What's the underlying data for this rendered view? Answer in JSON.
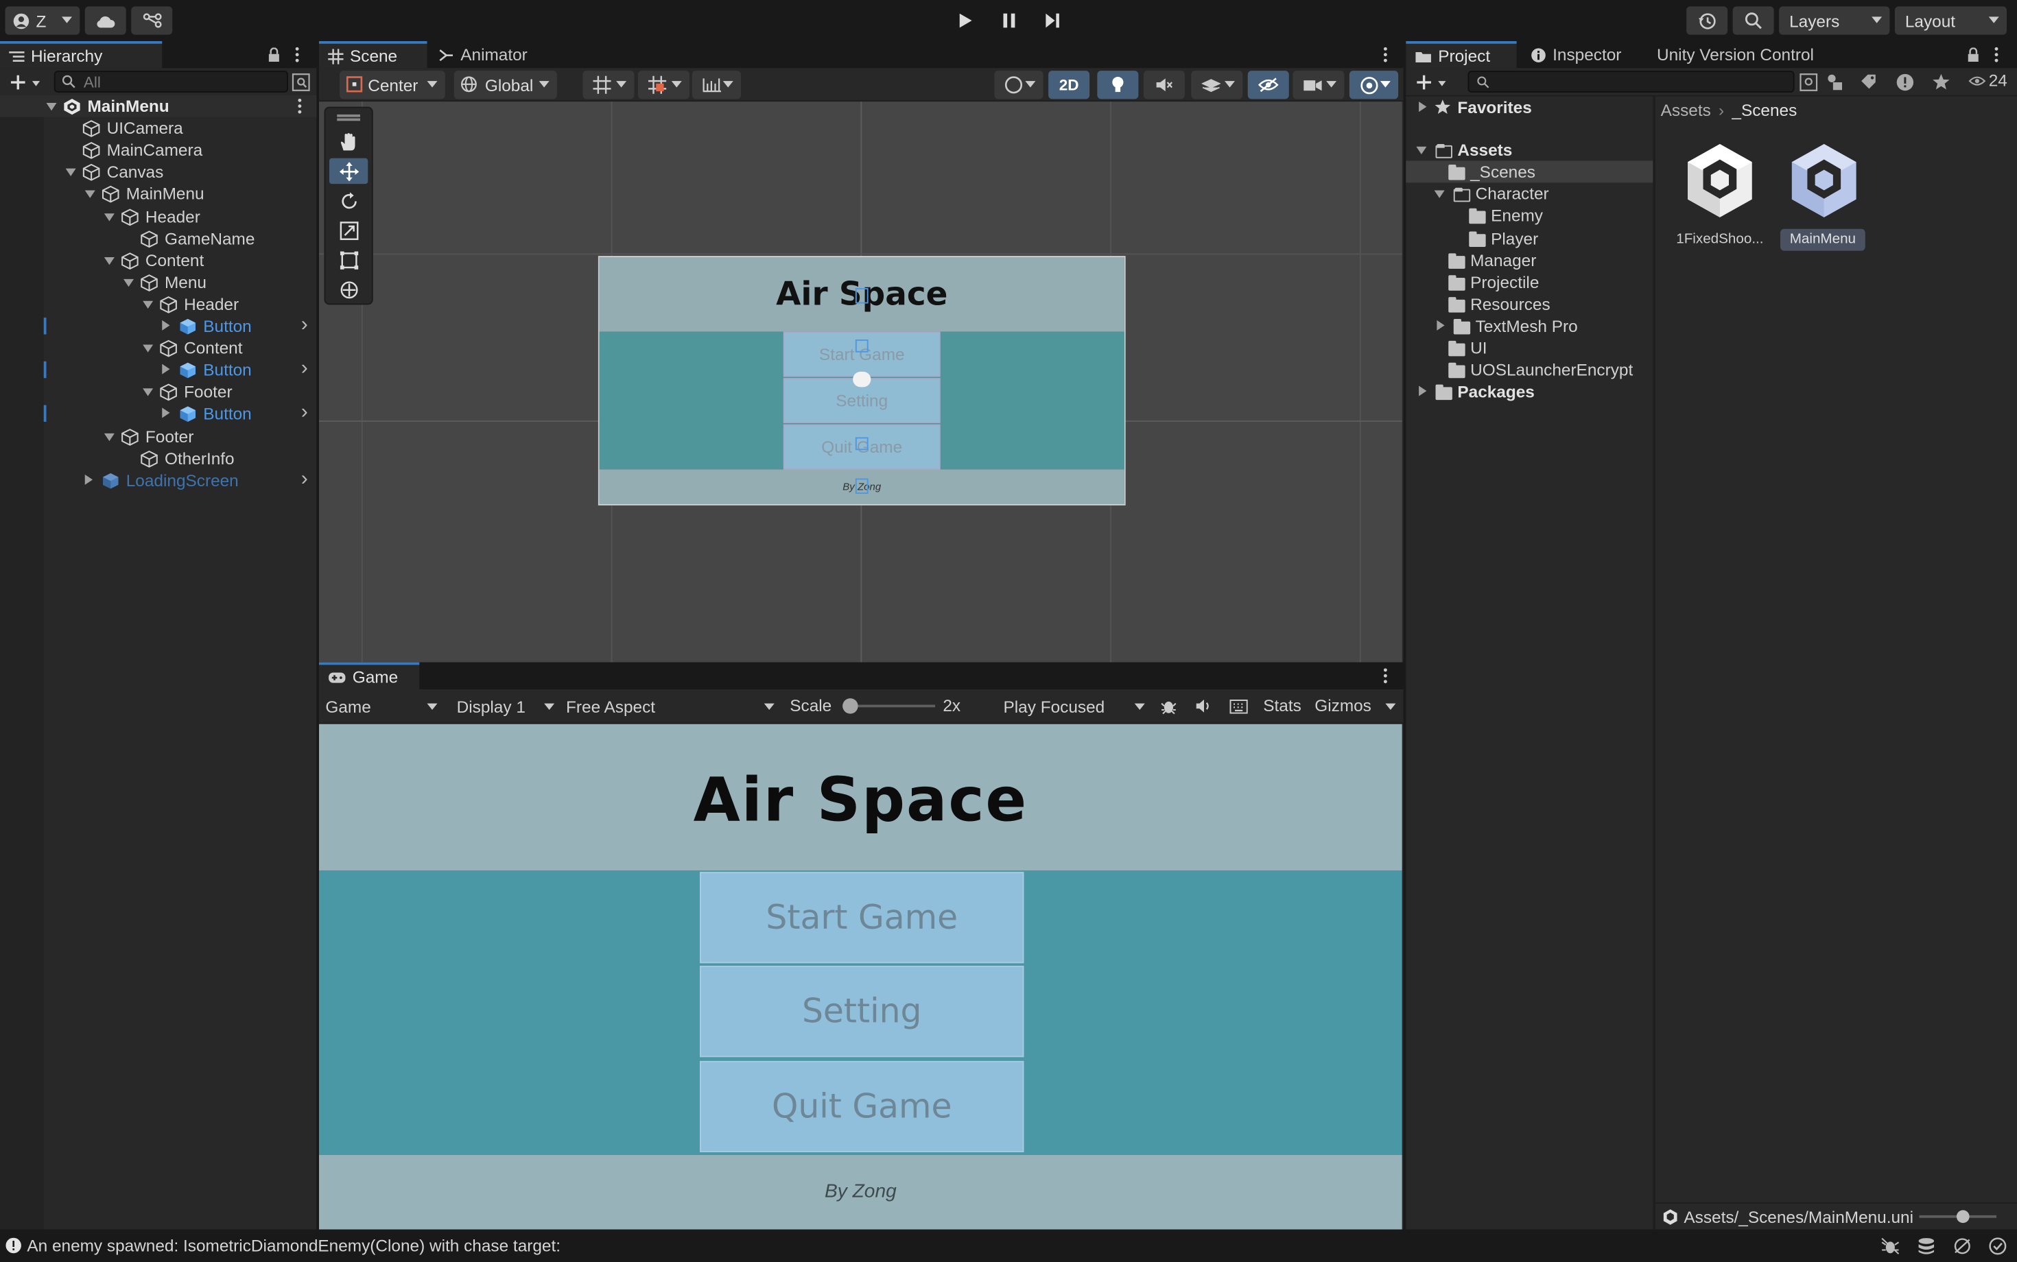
{
  "toolbar": {
    "account_initial": "Z",
    "layers_label": "Layers",
    "layout_label": "Layout"
  },
  "hierarchy": {
    "tab_label": "Hierarchy",
    "search_placeholder": "All",
    "items": [
      {
        "label": "MainMenu"
      },
      {
        "label": "UICamera"
      },
      {
        "label": "MainCamera"
      },
      {
        "label": "Canvas"
      },
      {
        "label": "MainMenu"
      },
      {
        "label": "Header"
      },
      {
        "label": "GameName"
      },
      {
        "label": "Content"
      },
      {
        "label": "Menu"
      },
      {
        "label": "Header"
      },
      {
        "label": "Button"
      },
      {
        "label": "Content"
      },
      {
        "label": "Button"
      },
      {
        "label": "Footer"
      },
      {
        "label": "Button"
      },
      {
        "label": "Footer"
      },
      {
        "label": "OtherInfo"
      },
      {
        "label": "LoadingScreen"
      }
    ]
  },
  "scene": {
    "tabs": [
      {
        "label": "Scene"
      },
      {
        "label": "Animator"
      }
    ],
    "pivot_mode": "Center",
    "pivot_rotation": "Global",
    "mode_2d": "2D",
    "preview": {
      "title": "Air Space",
      "buttons": [
        "Start Game",
        "Setting",
        "Quit Game"
      ],
      "footer": "By Zong"
    }
  },
  "game": {
    "tab_label": "Game",
    "view_select": "Game",
    "display_select": "Display 1",
    "aspect_select": "Free Aspect",
    "scale_label": "Scale",
    "scale_value": "2x",
    "scale_fraction": 0.0,
    "play_mode_select": "Play Focused",
    "stats_label": "Stats",
    "gizmos_label": "Gizmos",
    "content": {
      "title": "Air Space",
      "buttons": [
        "Start Game",
        "Setting",
        "Quit Game"
      ],
      "footer": "By Zong"
    },
    "colors": {
      "header": "#97b3b9",
      "content": "#4a97a5",
      "button": "#90bfdb",
      "footer": "#97b3b9"
    }
  },
  "project": {
    "tabs": [
      {
        "label": "Project"
      },
      {
        "label": "Inspector"
      },
      {
        "label": "Unity Version Control"
      }
    ],
    "visible_count": "24",
    "tree": [
      {
        "label": "Favorites"
      },
      {
        "label": "Assets"
      },
      {
        "label": "_Scenes"
      },
      {
        "label": "Character"
      },
      {
        "label": "Enemy"
      },
      {
        "label": "Player"
      },
      {
        "label": "Manager"
      },
      {
        "label": "Projectile"
      },
      {
        "label": "Resources"
      },
      {
        "label": "TextMesh Pro"
      },
      {
        "label": "UI"
      },
      {
        "label": "UOSLauncherEncrypt"
      },
      {
        "label": "Packages"
      }
    ],
    "breadcrumb": [
      "Assets",
      "_Scenes"
    ],
    "assets": [
      {
        "label": "1FixedShoo..."
      },
      {
        "label": "MainMenu"
      }
    ],
    "footer_path": "Assets/_Scenes/MainMenu.uni",
    "thumb_size_fraction": 0.58
  },
  "status_bar": {
    "message": "An enemy spawned: IsometricDiamondEnemy(Clone) with chase target:"
  }
}
